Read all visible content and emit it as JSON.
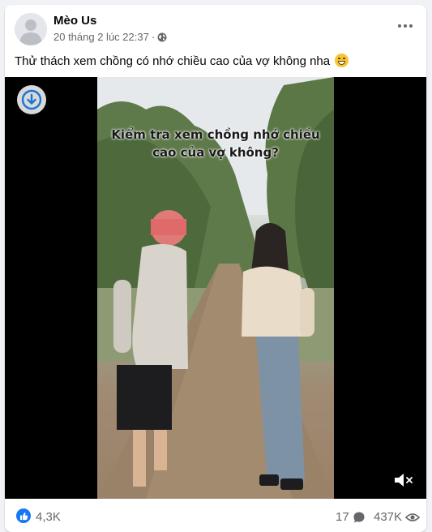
{
  "post": {
    "author": "Mèo Us",
    "timestamp": "20 tháng 2 lúc 22:37",
    "separator": "·",
    "audience_icon": "globe-icon",
    "more_icon": "more-horizontal-icon",
    "caption": "Thử thách xem chồng có nhớ chiều cao của vợ không nha",
    "caption_emoji": "grinning-face-emoji"
  },
  "video": {
    "overlay_line1": "Kiểm tra xem chồng nhớ chiều",
    "overlay_line2": "cao của vợ không?",
    "download_icon": "download-icon",
    "mute_icon": "speaker-muted-icon"
  },
  "stats": {
    "reaction_icon": "like-icon",
    "likes": "4,3K",
    "comments": "17",
    "comment_icon": "comment-icon",
    "views": "437K",
    "view_icon": "eye-icon"
  },
  "colors": {
    "accent": "#1877f2",
    "secondary_text": "#65676b",
    "video_background": "#000000"
  }
}
